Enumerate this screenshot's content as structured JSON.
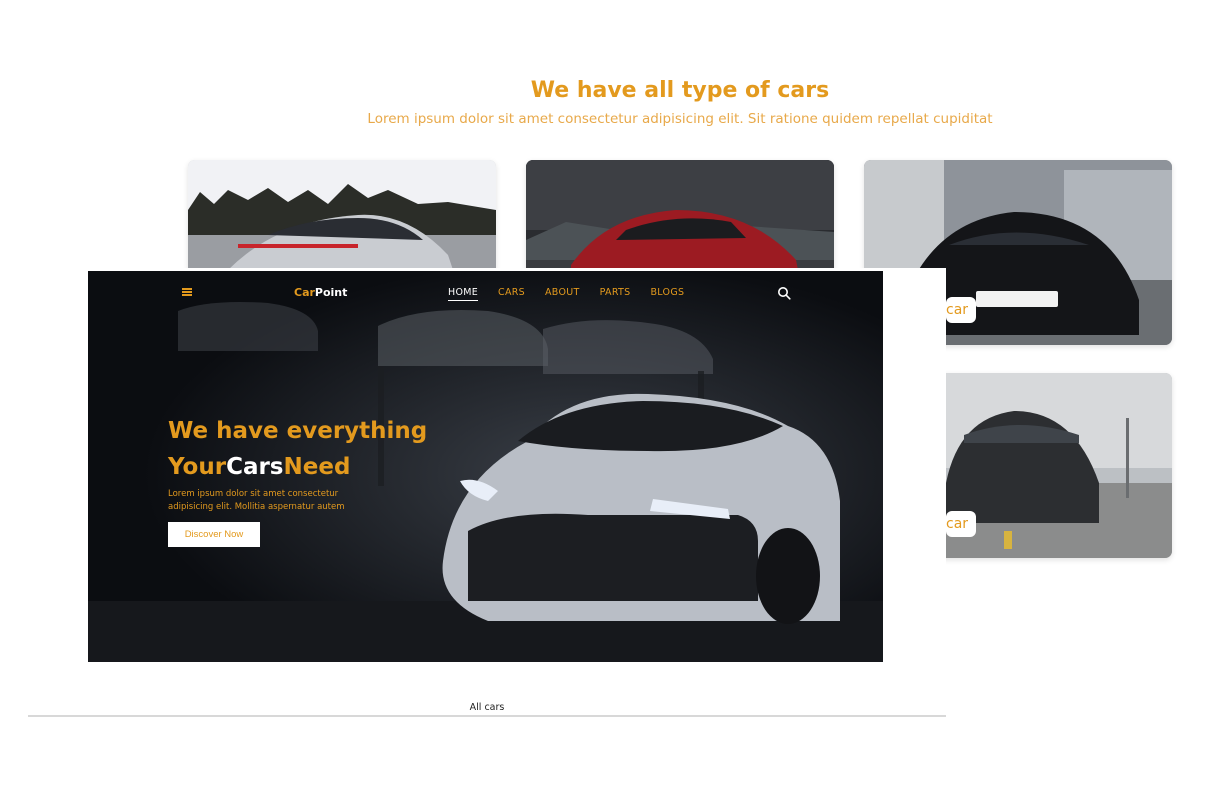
{
  "section": {
    "title": "We have all type of cars",
    "subtitle": "Lorem ipsum dolor sit amet consectetur adipisicing elit. Sit ratione quidem repellat cupiditat"
  },
  "cards": [
    {
      "name": "porsche-panamera-card",
      "label": ""
    },
    {
      "name": "audi-r8-red-card",
      "label": ""
    },
    {
      "name": "audi-r8-black-card",
      "label": "car"
    },
    {
      "name": "mustang-card",
      "label": "car"
    }
  ],
  "hero": {
    "logo_part1": "Car",
    "logo_part2": "Point",
    "nav": [
      "HOME",
      "CARS",
      "ABOUT",
      "PARTS",
      "BLOGS"
    ],
    "headline_line1": "We have everything",
    "headline_w1": "Your",
    "headline_w2": "Cars",
    "headline_w3": "Need",
    "paragraph": "Lorem ipsum dolor sit amet consectetur adipisicing elit. Mollitia aspernatur autem",
    "button_label": "Discover Now",
    "icons": {
      "menu": "menu-icon",
      "search": "search-icon"
    }
  },
  "footer_tab": {
    "label": "All cars"
  },
  "colors": {
    "accent": "#e39a1e",
    "hero_bg": "#0c0e12",
    "text_white": "#ffffff"
  }
}
